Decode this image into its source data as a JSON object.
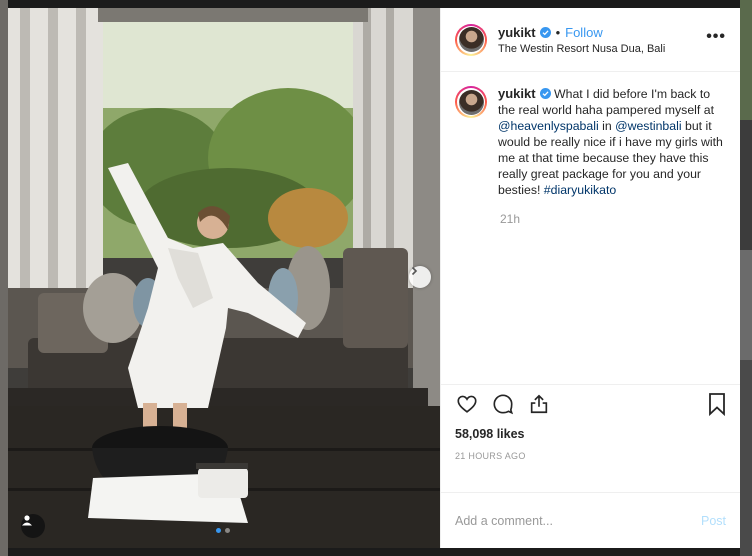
{
  "post": {
    "username": "yukikt",
    "follow_label": "Follow",
    "separator": "•",
    "location": "The Westin Resort Nusa Dua, Bali",
    "more_label": "•••",
    "verified": true
  },
  "caption": {
    "username": "yukikt",
    "text_1": "What I did before I'm back to the real world haha pampered myself at ",
    "mention_1": "@heavenlyspabali",
    "text_2": " in ",
    "mention_2": "@westinbali",
    "text_3": " but it would be really nice if i have my girls with me at that time because they have this really great package for you and your besties! ",
    "hashtag": "#diaryukikato",
    "time_ago": "21h"
  },
  "actions": {
    "icons": [
      "heart-icon",
      "comment-icon",
      "share-icon",
      "bookmark-icon"
    ],
    "likes": "58,098 likes",
    "timestamp": "21 HOURS AGO"
  },
  "composer": {
    "placeholder": "Add a comment...",
    "post_label": "Post"
  },
  "carousel": {
    "current_index": 1,
    "total": 2
  },
  "colors": {
    "accent": "#3897f0",
    "text": "#262626",
    "muted": "#999999",
    "post_disabled": "#b2dffc",
    "mention": "#003569"
  }
}
